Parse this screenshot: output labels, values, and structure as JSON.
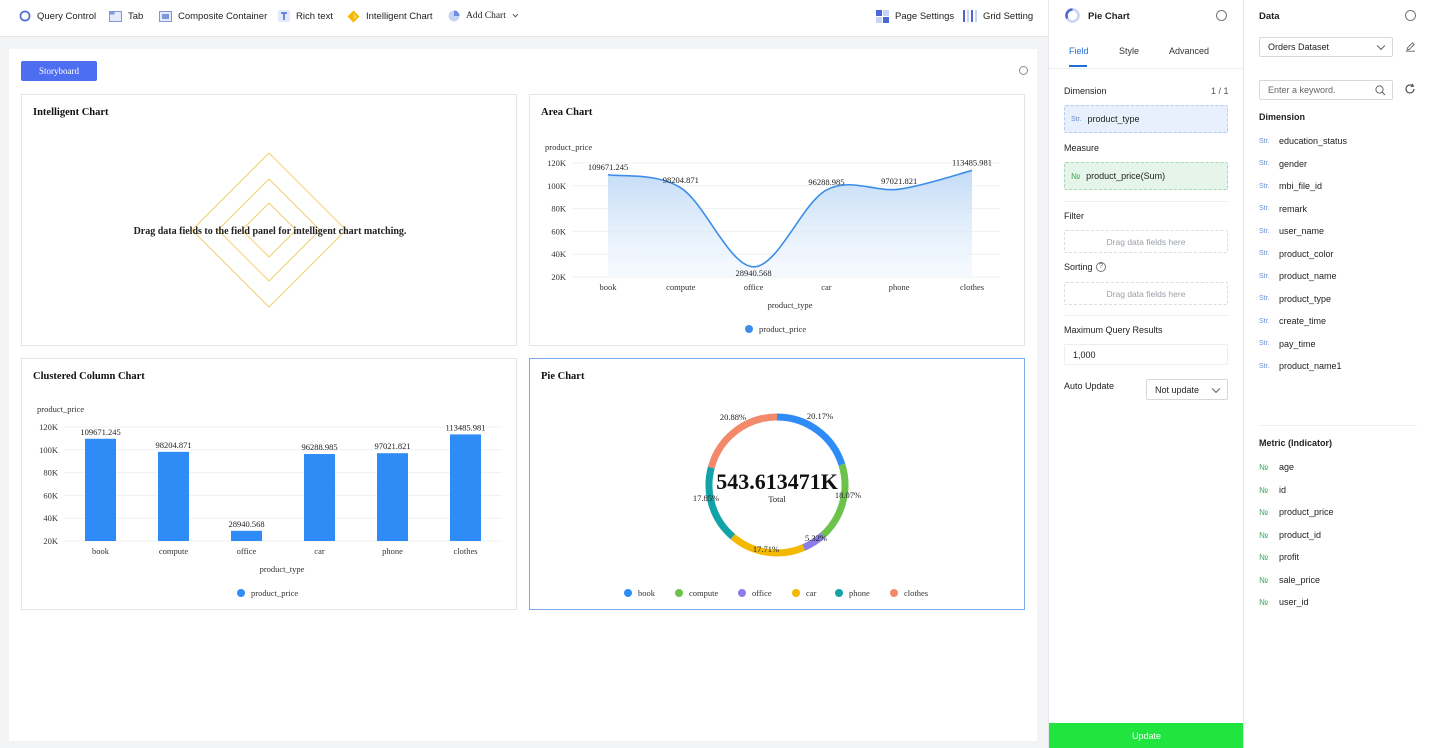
{
  "toolbar": {
    "query_control": "Query Control",
    "tab": "Tab",
    "composite_container": "Composite Container",
    "rich_text": "Rich text",
    "intelligent_chart": "Intelligent Chart",
    "add_chart": "Add Chart",
    "page_settings": "Page Settings",
    "grid_setting": "Grid Setting"
  },
  "canvas": {
    "storyboard": "Storyboard",
    "intelligent_card": {
      "title": "Intelligent Chart",
      "message": "Drag data fields to the field panel for intelligent chart matching."
    },
    "area_card": {
      "title": "Area Chart"
    },
    "column_card": {
      "title": "Clustered Column Chart"
    },
    "pie_card": {
      "title": "Pie Chart",
      "total_value": "543.613471K",
      "total_label": "Total"
    }
  },
  "chart_data": [
    {
      "type": "area",
      "title": "Area Chart",
      "categories": [
        "book",
        "compute",
        "office",
        "car",
        "phone",
        "clothes"
      ],
      "series": [
        {
          "name": "product_price",
          "values": [
            109671.245,
            98204.871,
            28940.568,
            96288.985,
            97021.821,
            113485.981
          ]
        }
      ],
      "data_labels": [
        "109671.245",
        "98204.871",
        "28940.568",
        "96288.985",
        "97021.821",
        "113485.981"
      ],
      "xlabel": "product_type",
      "ylabel": "product_price",
      "ylim": [
        20000,
        120000
      ],
      "yticks": [
        "120K",
        "100K",
        "80K",
        "60K",
        "40K",
        "20K"
      ],
      "legend": "product_price",
      "legend_position": "bottom",
      "color": "#3b8de9"
    },
    {
      "type": "bar",
      "title": "Clustered Column Chart",
      "categories": [
        "book",
        "compute",
        "office",
        "car",
        "phone",
        "clothes"
      ],
      "series": [
        {
          "name": "product_price",
          "values": [
            109671.245,
            98204.871,
            28940.568,
            96288.985,
            97021.821,
            113485.981
          ]
        }
      ],
      "data_labels": [
        "109671.245",
        "98204.871",
        "28940.568",
        "96288.985",
        "97021.821",
        "113485.981"
      ],
      "xlabel": "product_type",
      "ylabel": "product_price",
      "ylim": [
        20000,
        120000
      ],
      "yticks": [
        "120K",
        "100K",
        "80K",
        "60K",
        "40K",
        "20K"
      ],
      "legend": "product_price",
      "legend_position": "bottom",
      "color": "#2f8cf7"
    },
    {
      "type": "pie",
      "title": "Pie Chart",
      "categories": [
        "book",
        "compute",
        "office",
        "car",
        "phone",
        "clothes"
      ],
      "values": [
        109671.245,
        98204.871,
        28940.568,
        96288.985,
        97021.821,
        113485.981
      ],
      "percent_labels": [
        "20.17%",
        "18.07%",
        "5.32%",
        "17.71%",
        "17.85%",
        "20.88%"
      ],
      "colors": [
        "#2f8cf7",
        "#6cc24a",
        "#8b7ee8",
        "#f5b800",
        "#11a3a8",
        "#f2896b"
      ],
      "center_value": "543.613471K",
      "center_label": "Total",
      "legend_position": "bottom"
    }
  ],
  "props": {
    "title": "Pie Chart",
    "tabs": [
      "Field",
      "Style",
      "Advanced"
    ],
    "dimension_label": "Dimension",
    "dimension_count": "1 / 1",
    "dimension_tag": "Str.",
    "dimension_field": "product_type",
    "measure_label": "Measure",
    "measure_tag": "№",
    "measure_field": "product_price(Sum)",
    "filter_label": "Filter",
    "filter_placeholder": "Drag data fields here",
    "sorting_label": "Sorting",
    "sorting_placeholder": "Drag data fields here",
    "max_results_label": "Maximum Query Results",
    "max_results_value": "1,000",
    "auto_update_label": "Auto Update",
    "auto_update_value": "Not update",
    "update_button": "Update"
  },
  "data_panel": {
    "title": "Data",
    "dataset": "Orders Dataset",
    "search_placeholder": "Enter a keyword.",
    "dimension_title": "Dimension",
    "dimension_tag": "Str.",
    "dimensions": [
      "education_status",
      "gender",
      "mbi_file_id",
      "remark",
      "user_name",
      "product_color",
      "product_name",
      "product_type",
      "create_time",
      "pay_time",
      "product_name1"
    ],
    "metric_title": "Metric (Indicator)",
    "metric_tag": "№",
    "metrics": [
      "age",
      "id",
      "product_price",
      "product_id",
      "profit",
      "sale_price",
      "user_id"
    ]
  },
  "colors": {
    "accent": "#1e6fd9",
    "update_green": "#1fe53e",
    "storyboard_blue": "#4e6ef2"
  }
}
